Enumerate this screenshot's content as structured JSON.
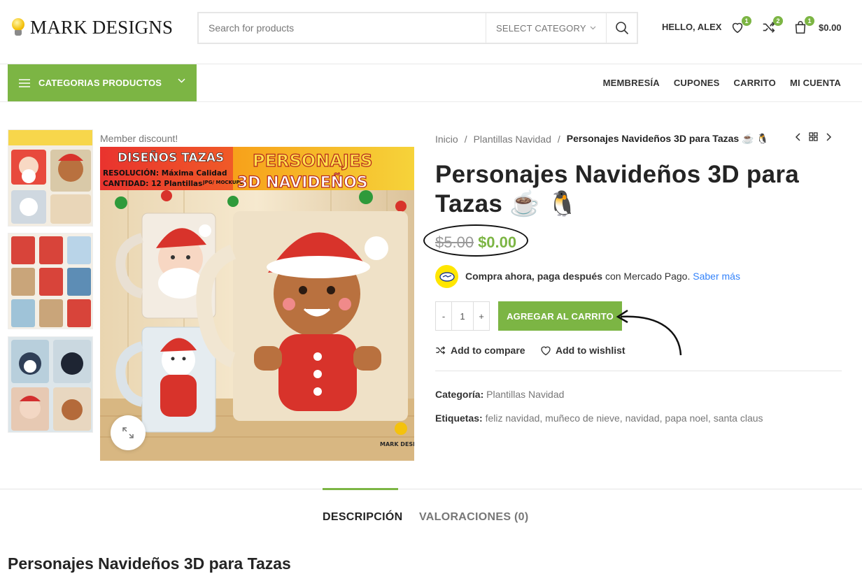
{
  "header": {
    "logo_text": "MARK DESIGNS",
    "search_placeholder": "Search for products",
    "category_select": "SELECT CATEGORY",
    "greeting": "HELLO, ALEX",
    "wishlist_count": "1",
    "compare_count": "2",
    "cart_count": "1",
    "cart_total": "$0.00"
  },
  "nav": {
    "categories_button": "CATEGORIAS PRODUCTOS",
    "links": [
      "MEMBRESÍA",
      "CUPONES",
      "CARRITO",
      "MI CUENTA"
    ]
  },
  "gallery": {
    "member_discount": "Member discount!",
    "image_banner": {
      "left_title": "DISEÑOS TAZAS",
      "resolution": "RESOLUCIÓN: Máxima Calidad",
      "quantity": "CANTIDAD: 12 Plantillas",
      "format": "JPG/ MOCKUPS",
      "right_title_1": "PERSONAJES",
      "right_title_2": "3D NAVIDEÑOS",
      "watermark": "MARK DESIGNS"
    }
  },
  "breadcrumb": {
    "home": "Inicio",
    "category": "Plantillas Navidad",
    "current": "Personajes Navideños 3D para Tazas ☕ 🐧"
  },
  "product": {
    "title": "Personajes Navideños 3D para Tazas ☕ 🐧",
    "old_price": "$5.00",
    "new_price": "$0.00",
    "mp_bold": "Compra ahora, paga después",
    "mp_text": " con Mercado Pago. ",
    "mp_link": "Saber más",
    "qty_minus": "-",
    "qty_value": "1",
    "qty_plus": "+",
    "add_to_cart": "AGREGAR AL CARRITO",
    "add_to_compare": "Add to compare",
    "add_to_wishlist": "Add to wishlist",
    "category_label": "Categoría:",
    "category_value": "Plantillas Navidad",
    "tags_label": "Etiquetas:",
    "tags": "feliz navidad, muñeco de nieve, navidad, papa noel, santa claus"
  },
  "tabs": {
    "description": "DESCRIPCIÓN",
    "reviews": "VALORACIONES (0)"
  },
  "description_title": "Personajes Navideños 3D para Tazas",
  "colors": {
    "accent": "#7cb544",
    "link": "#3483fa"
  }
}
